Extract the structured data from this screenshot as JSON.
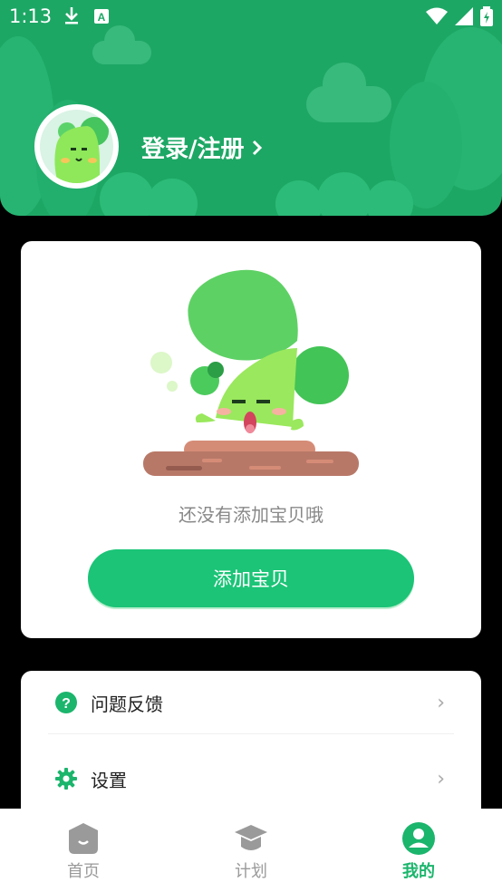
{
  "status_bar": {
    "time": "1:13"
  },
  "header": {
    "login_label": "登录/注册"
  },
  "baby_card": {
    "empty_text": "还没有添加宝贝哦",
    "add_button_label": "添加宝贝"
  },
  "menu": {
    "items": [
      {
        "label": "问题反馈",
        "icon": "question-circle-icon"
      },
      {
        "label": "设置",
        "icon": "gear-icon"
      }
    ]
  },
  "tabbar": {
    "tabs": [
      {
        "label": "首页",
        "icon": "home-icon",
        "active": false
      },
      {
        "label": "计划",
        "icon": "graduation-cap-icon",
        "active": false
      },
      {
        "label": "我的",
        "icon": "user-icon",
        "active": true
      }
    ]
  },
  "colors": {
    "primary": "#1bc477",
    "header_bg": "#1da765",
    "active_tab": "#1bb56c"
  }
}
